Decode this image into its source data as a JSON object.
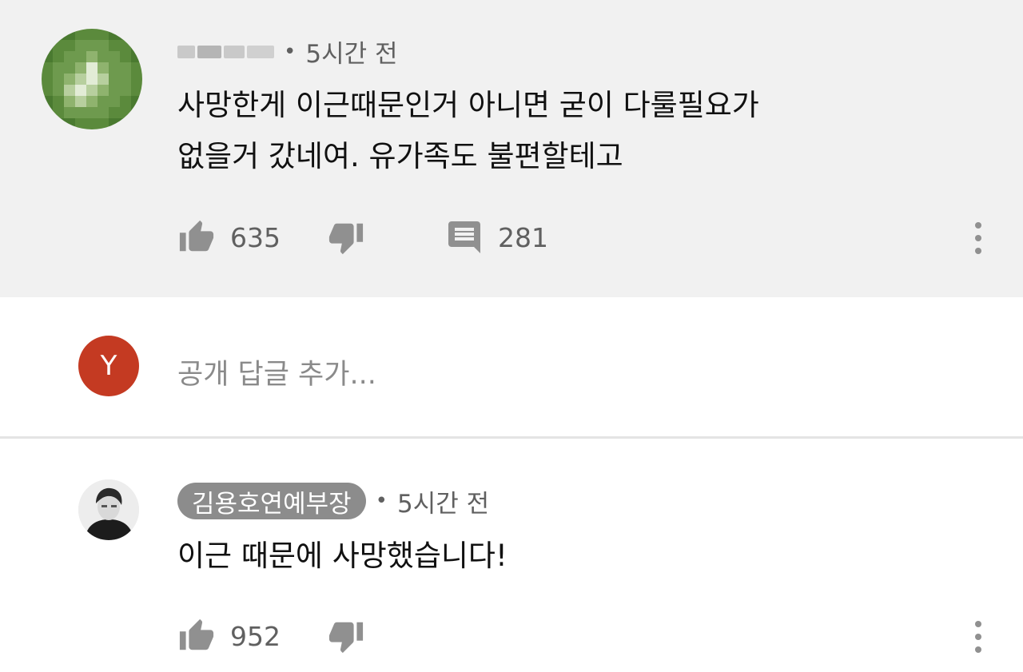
{
  "comment1": {
    "author_hidden": true,
    "time": "5시간 전",
    "text_line1": "사망한게 이근때문인거 아니면 굳이 다룰필요가",
    "text_line2": "없을거 갔네여. 유가족도 불편할테고",
    "likes": "635",
    "replies": "281",
    "bg_color": "#f1f1f1"
  },
  "reply_box": {
    "avatar_letter": "Y",
    "avatar_color": "#c43a22",
    "placeholder": "공개 답글 추가..."
  },
  "comment2": {
    "author": "김용호연예부장",
    "time": "5시간 전",
    "text": "이근 때문에 사망했습니다!",
    "likes": "952"
  },
  "icons": {
    "like": "thumb-up-icon",
    "dislike": "thumb-down-icon",
    "reply": "comment-icon",
    "more": "more-vert-icon"
  }
}
